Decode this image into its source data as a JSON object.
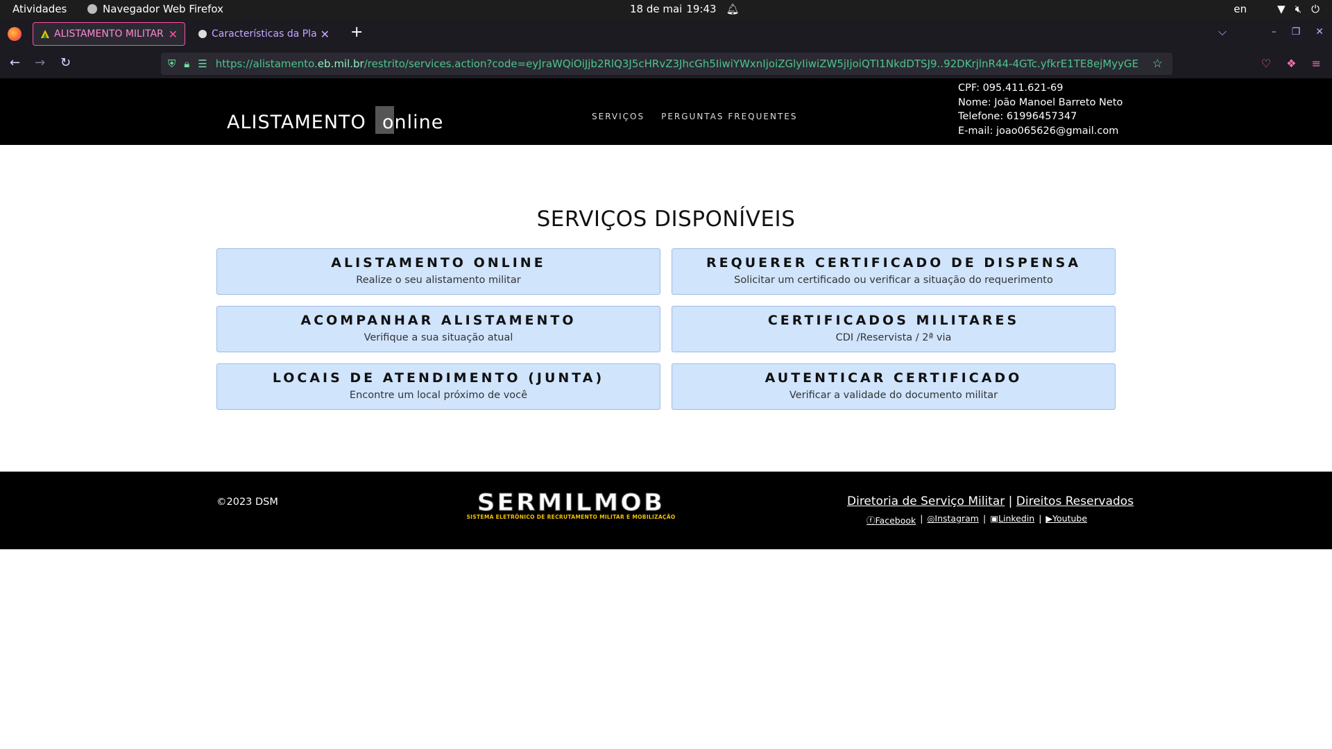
{
  "os_bar": {
    "activities": "Atividades",
    "app_name": "Navegador Web Firefox",
    "date": "18 de mai",
    "time": "19:43",
    "language": "en"
  },
  "browser": {
    "tabs": [
      {
        "title": "ALISTAMENTO MILITAR O",
        "active": true
      },
      {
        "title": "Características da Platafor",
        "active": false
      }
    ],
    "url_prefix": "https://alistamento.",
    "url_host": "eb.mil.br",
    "url_suffix": "/restrito/services.action?code=eyJraWQiOiJjb2RlQ3J5cHRvZ3JhcGh5IiwiYWxnIjoiZGlyIiwiZW5jIjoiQTI1NkdDTSJ9..92DKrjlnR44-4GTc.yfkrE1TE8ejMyyGEsYpnwMck"
  },
  "header": {
    "logo_main": "ALISTAMENTO",
    "logo_sub": "online",
    "nav": [
      "SERVIÇOS",
      "PERGUNTAS FREQUENTES"
    ],
    "user": {
      "cpf": "CPF: 095.411.621-69",
      "nome": "Nome: João Manoel Barreto Neto",
      "telefone": "Telefone: 61996457347",
      "email": "E-mail: joao065626@gmail.com"
    }
  },
  "main": {
    "title": "SERVIÇOS DISPONÍVEIS",
    "cards": [
      {
        "title": "ALISTAMENTO ONLINE",
        "subtitle": "Realize o seu alistamento militar"
      },
      {
        "title": "REQUERER CERTIFICADO DE DISPENSA",
        "subtitle": "Solicitar um certificado ou verificar a situação do requerimento"
      },
      {
        "title": "ACOMPANHAR ALISTAMENTO",
        "subtitle": "Verifique a sua situação atual"
      },
      {
        "title": "CERTIFICADOS MILITARES",
        "subtitle": "CDI /Reservista / 2ª via"
      },
      {
        "title": "LOCAIS DE ATENDIMENTO (JUNTA)",
        "subtitle": "Encontre um local próximo de você"
      },
      {
        "title": "AUTENTICAR CERTIFICADO",
        "subtitle": "Verificar a validade do documento militar"
      }
    ]
  },
  "footer": {
    "copyright": "©2023 DSM",
    "brand_name": "SERMILMOB",
    "brand_tagline": "SISTEMA ELETRÔNICO DE RECRUTAMENTO MILITAR E MOBILIZAÇÃO",
    "link_dsm": "Diretoria de Serviço Militar",
    "link_separator": "|",
    "link_rights": "Direitos Reservados",
    "social": [
      "Facebook",
      "Instagram",
      "Linkedin",
      "Youtube"
    ]
  }
}
